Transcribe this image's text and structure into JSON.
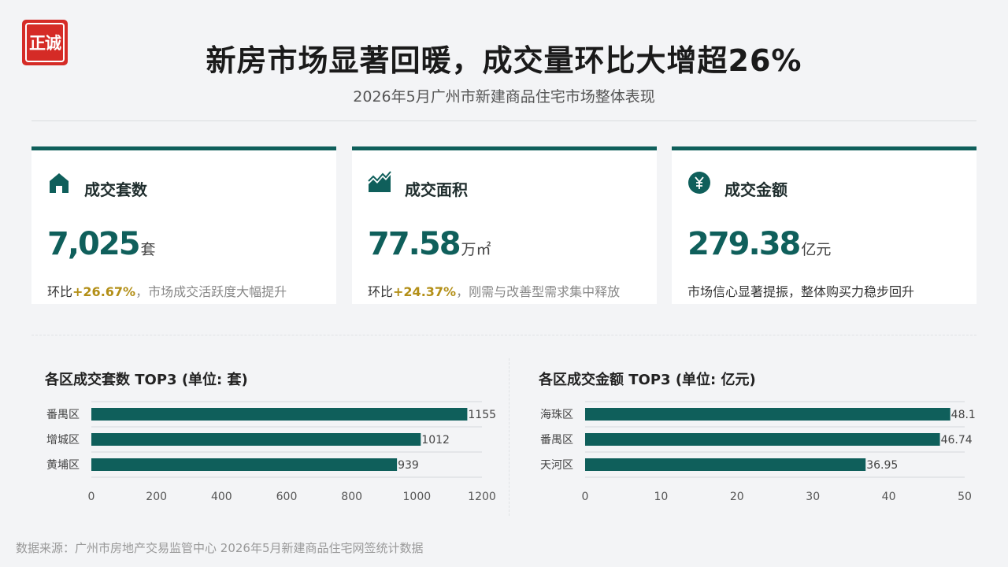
{
  "logo": {
    "text": "正诚"
  },
  "header": {
    "title": "新房市场显著回暖，成交量环比大增超26%",
    "subtitle": "2026年5月广州市新建商品住宅市场整体表现"
  },
  "cards": [
    {
      "icon": "house-icon",
      "label": "成交套数",
      "value": "7,025",
      "unit": "套",
      "desc_prefix": "环比",
      "desc_highlight": "+26.67%",
      "desc_suffix": "，市场成交活跃度大幅提升"
    },
    {
      "icon": "area-chart-icon",
      "label": "成交面积",
      "value": "77.58",
      "unit": "万㎡",
      "desc_prefix": "环比",
      "desc_highlight": "+24.37%",
      "desc_suffix": "，刚需与改善型需求集中释放"
    },
    {
      "icon": "yen-coin-icon",
      "label": "成交金额",
      "value": "279.38",
      "unit": "亿元",
      "desc_text": "市场信心显著提振，整体购买力稳步回升"
    }
  ],
  "colors": {
    "accent": "#0f5f5b",
    "highlight": "#b38f17",
    "logo": "#d52b26"
  },
  "chart_data": [
    {
      "type": "bar",
      "orientation": "horizontal",
      "title": "各区成交套数 TOP3 (单位: 套)",
      "categories": [
        "番禺区",
        "增城区",
        "黄埔区"
      ],
      "values": [
        1155,
        1012,
        939
      ],
      "value_labels": [
        "1155",
        "1012",
        "939"
      ],
      "xlim": [
        0,
        1200
      ],
      "xticks": [
        0,
        200,
        400,
        600,
        800,
        1000,
        1200
      ],
      "grid": true
    },
    {
      "type": "bar",
      "orientation": "horizontal",
      "title": "各区成交金额 TOP3 (单位: 亿元)",
      "categories": [
        "海珠区",
        "番禺区",
        "天河区"
      ],
      "values": [
        48.1,
        46.74,
        36.95
      ],
      "value_labels": [
        "48.1",
        "46.74",
        "36.95"
      ],
      "xlim": [
        0,
        50
      ],
      "xticks": [
        0,
        10,
        20,
        30,
        40,
        50
      ],
      "grid": true
    }
  ],
  "footer": {
    "source": "数据来源：广州市房地产交易监管中心 2026年5月新建商品住宅网签统计数据"
  }
}
